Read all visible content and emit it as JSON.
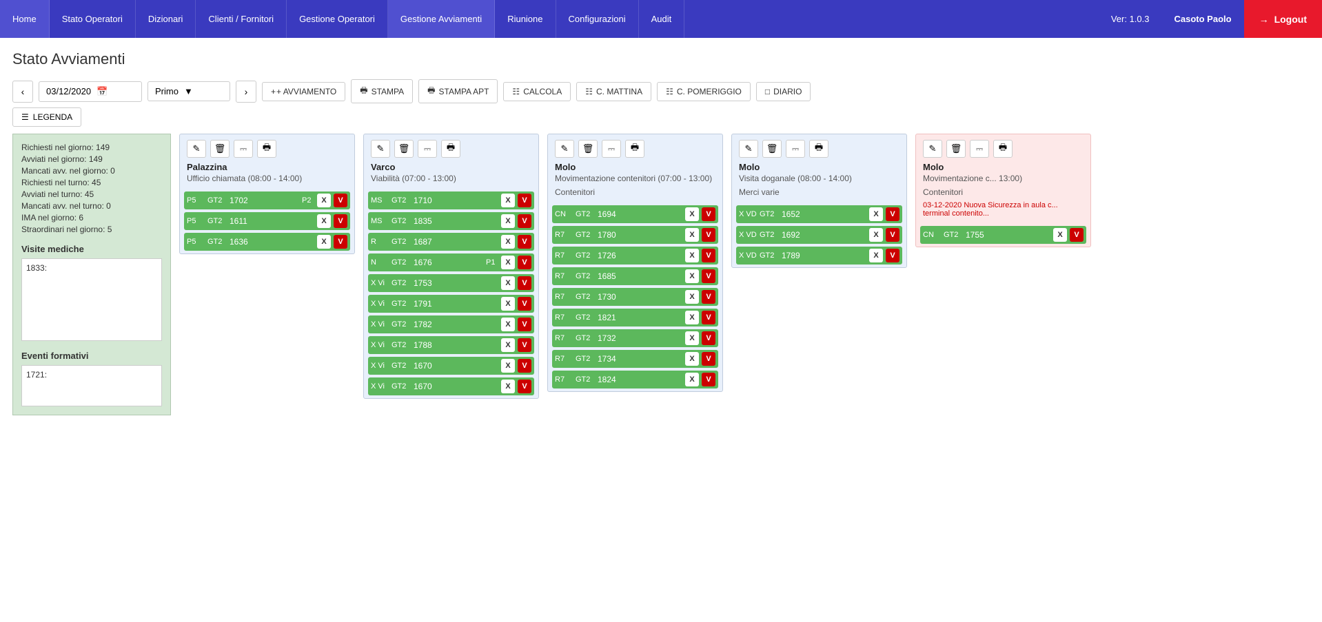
{
  "navbar": {
    "items": [
      {
        "label": "Home",
        "active": false
      },
      {
        "label": "Stato Operatori",
        "active": false
      },
      {
        "label": "Dizionari",
        "active": false
      },
      {
        "label": "Clienti / Fornitori",
        "active": false
      },
      {
        "label": "Gestione Operatori",
        "active": false
      },
      {
        "label": "Gestione Avviamenti",
        "active": true
      },
      {
        "label": "Riunione",
        "active": false
      },
      {
        "label": "Configurazioni",
        "active": false
      },
      {
        "label": "Audit",
        "active": false
      }
    ],
    "version": "Ver: 1.0.3",
    "user": "Casoto Paolo",
    "logout_label": "Logout"
  },
  "page": {
    "title": "Stato Avviamenti"
  },
  "toolbar": {
    "date": "03/12/2020",
    "shift": "Primo",
    "avviamento_label": "+ AVVIAMENTO",
    "stampa_label": "STAMPA",
    "stampa_apt_label": "STAMPA APT",
    "calcola_label": "CALCOLA",
    "c_mattina_label": "C. MATTINA",
    "c_pomeriggio_label": "C. POMERIGGIO",
    "diario_label": "DIARIO",
    "legenda_label": "LEGENDA"
  },
  "left_panel": {
    "stats": [
      "Richiesti nel giorno: 149",
      "Avviati nel giorno: 149",
      "Mancati avv. nel giorno: 0",
      "Richiesti nel turno: 45",
      "Avviati nel turno: 45",
      "Mancati avv. nel turno: 0",
      "IMA nel giorno: 6",
      "Straordinari nel giorno: 5"
    ],
    "visite_mediche_title": "Visite mediche",
    "visite_items": [
      "1833:"
    ],
    "eventi_formativi_title": "Eventi formativi",
    "eventi_items": [
      "1721:"
    ]
  },
  "cards": [
    {
      "id": "palazzina",
      "title": "Palazzina",
      "subtitle": "Ufficio chiamata (08:00 - 14:00)",
      "tag": "",
      "note": "",
      "pink": false,
      "rows": [
        {
          "label": "P5",
          "gt": "GT2",
          "num": "1702",
          "p": "P2"
        },
        {
          "label": "P5",
          "gt": "GT2",
          "num": "1611",
          "p": ""
        },
        {
          "label": "P5",
          "gt": "GT2",
          "num": "1636",
          "p": ""
        }
      ]
    },
    {
      "id": "varco",
      "title": "Varco",
      "subtitle": "Viabilità (07:00 - 13:00)",
      "tag": "",
      "note": "",
      "pink": false,
      "rows": [
        {
          "label": "MS",
          "gt": "GT2",
          "num": "1710",
          "p": ""
        },
        {
          "label": "MS",
          "gt": "GT2",
          "num": "1835",
          "p": ""
        },
        {
          "label": "R",
          "gt": "GT2",
          "num": "1687",
          "p": ""
        },
        {
          "label": "N",
          "gt": "GT2",
          "num": "1676",
          "p": "P1"
        },
        {
          "label": "X Vi",
          "gt": "GT2",
          "num": "1753",
          "p": ""
        },
        {
          "label": "X Vi",
          "gt": "GT2",
          "num": "1791",
          "p": ""
        },
        {
          "label": "X Vi",
          "gt": "GT2",
          "num": "1782",
          "p": ""
        },
        {
          "label": "X Vi",
          "gt": "GT2",
          "num": "1788",
          "p": ""
        },
        {
          "label": "X Vi",
          "gt": "GT2",
          "num": "1670",
          "p": ""
        },
        {
          "label": "X Vi",
          "gt": "GT2",
          "num": "1670",
          "p": ""
        }
      ]
    },
    {
      "id": "molo1",
      "title": "Molo",
      "subtitle": "Movimentazione contenitori (07:00 - 13:00)",
      "tag": "Contenitori",
      "note": "",
      "pink": false,
      "rows": [
        {
          "label": "CN",
          "gt": "GT2",
          "num": "1694",
          "p": ""
        },
        {
          "label": "R7",
          "gt": "GT2",
          "num": "1780",
          "p": ""
        },
        {
          "label": "R7",
          "gt": "GT2",
          "num": "1726",
          "p": ""
        },
        {
          "label": "R7",
          "gt": "GT2",
          "num": "1685",
          "p": ""
        },
        {
          "label": "R7",
          "gt": "GT2",
          "num": "1730",
          "p": ""
        },
        {
          "label": "R7",
          "gt": "GT2",
          "num": "1821",
          "p": ""
        },
        {
          "label": "R7",
          "gt": "GT2",
          "num": "1732",
          "p": ""
        },
        {
          "label": "R7",
          "gt": "GT2",
          "num": "1734",
          "p": ""
        },
        {
          "label": "R7",
          "gt": "GT2",
          "num": "1824",
          "p": ""
        }
      ]
    },
    {
      "id": "molo2",
      "title": "Molo",
      "subtitle": "Visita doganale (08:00 - 14:00)",
      "tag": "Merci varie",
      "note": "",
      "pink": false,
      "rows": [
        {
          "label": "X VD",
          "gt": "GT2",
          "num": "1652",
          "p": ""
        },
        {
          "label": "X VD",
          "gt": "GT2",
          "num": "1692",
          "p": ""
        },
        {
          "label": "X VD",
          "gt": "GT2",
          "num": "1789",
          "p": ""
        }
      ]
    },
    {
      "id": "molo3",
      "title": "Molo",
      "subtitle": "Movimentazione c... 13:00)",
      "tag": "Contenitori",
      "note": "03-12-2020 Nuova Sicurezza in aula c... terminal contenito...",
      "pink": true,
      "rows": [
        {
          "label": "CN",
          "gt": "GT2",
          "num": "1755",
          "p": ""
        }
      ]
    }
  ]
}
